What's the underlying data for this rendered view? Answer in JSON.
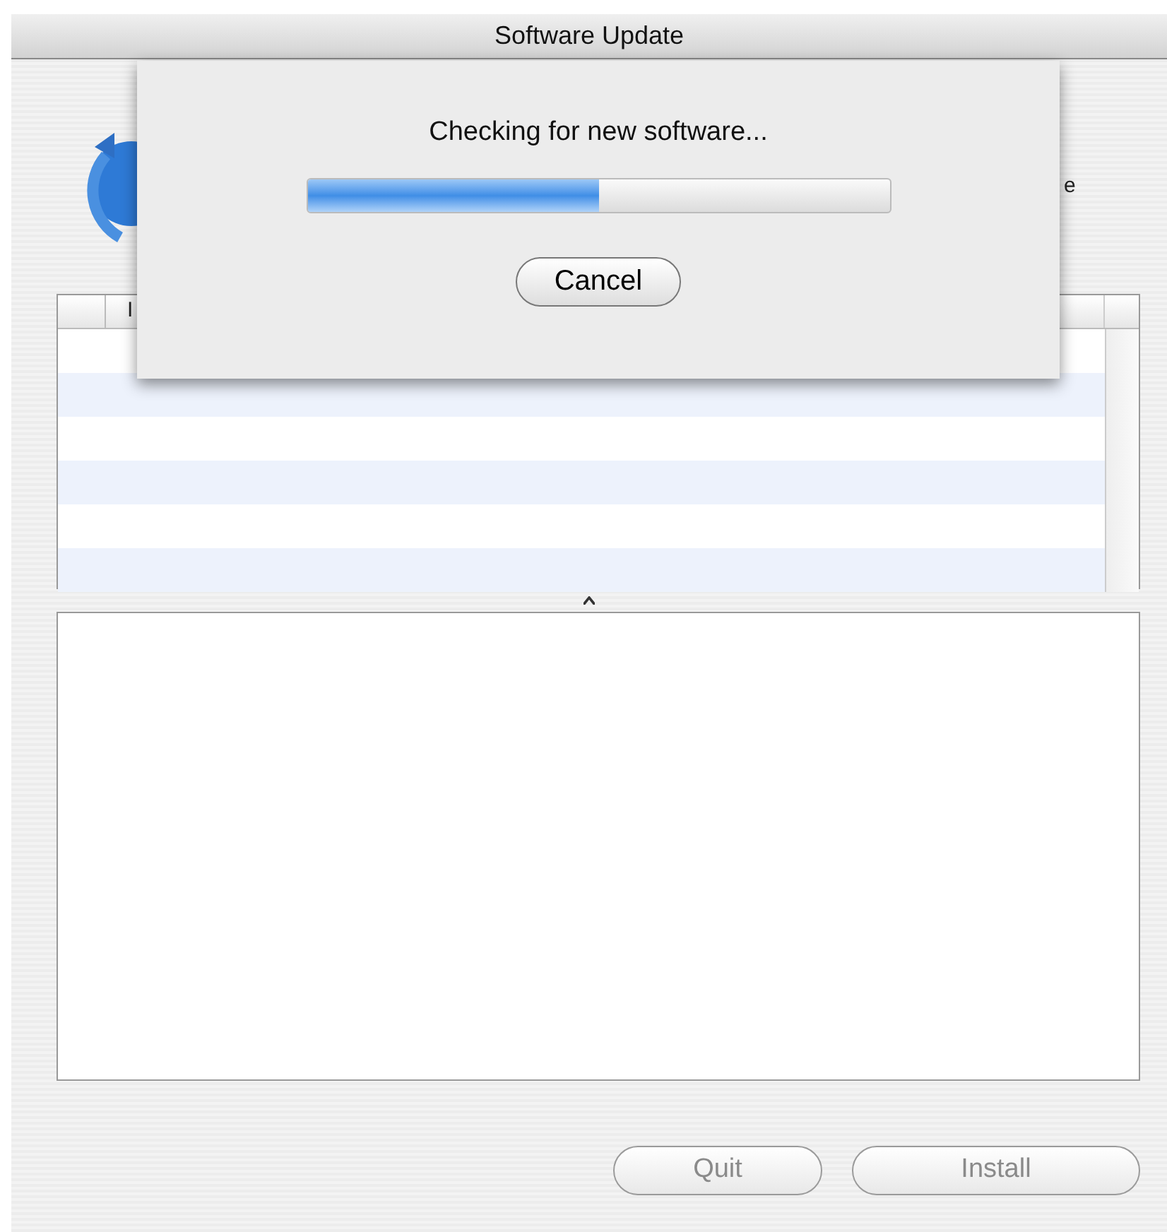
{
  "window": {
    "title": "Software Update"
  },
  "header": {
    "description_fragment": "e"
  },
  "table": {
    "columns": [
      "I"
    ]
  },
  "sheet": {
    "message": "Checking for new software...",
    "progress": {
      "level": 0.5
    },
    "button": "Cancel"
  },
  "buttons": [
    {
      "label": "Quit",
      "disabled": true
    },
    {
      "label": "Install",
      "disabled": true
    }
  ]
}
